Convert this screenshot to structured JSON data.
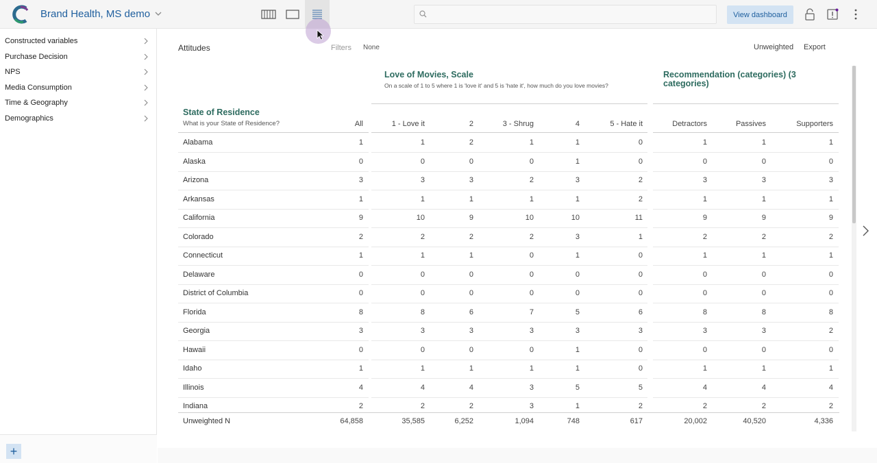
{
  "header": {
    "title": "Brand Health, MS demo",
    "search_placeholder": "",
    "view_dashboard_label": "View dashboard",
    "accent_color": "#1f5f9e"
  },
  "sidebar": {
    "items": [
      {
        "label": "Constructed variables"
      },
      {
        "label": "Purchase Decision"
      },
      {
        "label": "NPS"
      },
      {
        "label": "Media Consumption"
      },
      {
        "label": "Time & Geography"
      },
      {
        "label": "Demographics"
      }
    ],
    "add_label": "+"
  },
  "main": {
    "title": "Attitudes",
    "filters_label": "Filters",
    "filters_value": "None",
    "weight_label": "Unweighted",
    "export_label": "Export"
  },
  "table": {
    "row_variable": {
      "title": "State of Residence",
      "subtitle": "What is your State of Residence?"
    },
    "groups": [
      {
        "title": "Love of Movies, Scale",
        "subtitle": "On a scale of 1 to 5 where 1 is 'love it' and 5 is 'hate it', how much do you love movies?"
      },
      {
        "title": "Recommendation (categories) (3 categories)",
        "subtitle": ""
      }
    ],
    "columns": [
      "All",
      "1 - Love it",
      "2",
      "3 - Shrug",
      "4",
      "5 - Hate it",
      "Detractors",
      "Passives",
      "Supporters"
    ],
    "rows": [
      {
        "label": "Alabama",
        "values": [
          "1",
          "1",
          "2",
          "1",
          "1",
          "0",
          "1",
          "1",
          "1"
        ]
      },
      {
        "label": "Alaska",
        "values": [
          "0",
          "0",
          "0",
          "0",
          "1",
          "0",
          "0",
          "0",
          "0"
        ]
      },
      {
        "label": "Arizona",
        "values": [
          "3",
          "3",
          "3",
          "2",
          "3",
          "2",
          "3",
          "3",
          "3"
        ]
      },
      {
        "label": "Arkansas",
        "values": [
          "1",
          "1",
          "1",
          "1",
          "1",
          "2",
          "1",
          "1",
          "1"
        ]
      },
      {
        "label": "California",
        "values": [
          "9",
          "10",
          "9",
          "10",
          "10",
          "11",
          "9",
          "9",
          "9"
        ]
      },
      {
        "label": "Colorado",
        "values": [
          "2",
          "2",
          "2",
          "2",
          "3",
          "1",
          "2",
          "2",
          "2"
        ]
      },
      {
        "label": "Connecticut",
        "values": [
          "1",
          "1",
          "1",
          "0",
          "1",
          "0",
          "1",
          "1",
          "1"
        ]
      },
      {
        "label": "Delaware",
        "values": [
          "0",
          "0",
          "0",
          "0",
          "0",
          "0",
          "0",
          "0",
          "0"
        ]
      },
      {
        "label": "District of Columbia",
        "values": [
          "0",
          "0",
          "0",
          "0",
          "0",
          "0",
          "0",
          "0",
          "0"
        ]
      },
      {
        "label": "Florida",
        "values": [
          "8",
          "8",
          "6",
          "7",
          "5",
          "6",
          "8",
          "8",
          "8"
        ]
      },
      {
        "label": "Georgia",
        "values": [
          "3",
          "3",
          "3",
          "3",
          "3",
          "3",
          "3",
          "3",
          "2"
        ]
      },
      {
        "label": "Hawaii",
        "values": [
          "0",
          "0",
          "0",
          "0",
          "1",
          "0",
          "0",
          "0",
          "0"
        ]
      },
      {
        "label": "Idaho",
        "values": [
          "1",
          "1",
          "1",
          "1",
          "1",
          "0",
          "1",
          "1",
          "1"
        ]
      },
      {
        "label": "Illinois",
        "values": [
          "4",
          "4",
          "4",
          "3",
          "5",
          "5",
          "4",
          "4",
          "4"
        ]
      },
      {
        "label": "Indiana",
        "values": [
          "2",
          "2",
          "2",
          "3",
          "1",
          "2",
          "2",
          "2",
          "2"
        ]
      }
    ],
    "footer": {
      "label": "Unweighted N",
      "values": [
        "64,858",
        "35,585",
        "6,252",
        "1,094",
        "748",
        "617",
        "20,002",
        "40,520",
        "4,336"
      ]
    }
  }
}
